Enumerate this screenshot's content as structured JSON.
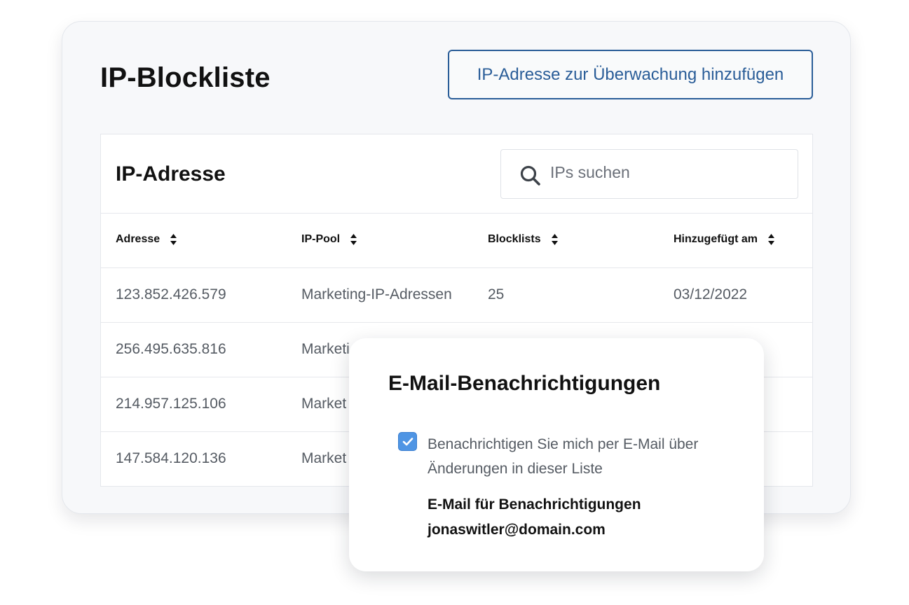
{
  "page": {
    "title": "IP-Blockliste",
    "add_button_label": "IP-Adresse zur Überwachung hinzufügen"
  },
  "table": {
    "title": "IP-Adresse",
    "search": {
      "placeholder": "IPs suchen",
      "icon": "search-icon"
    },
    "columns": [
      "Adresse",
      "IP-Pool",
      "Blocklists",
      "Hinzugefügt am"
    ],
    "rows": [
      {
        "address": "123.852.426.579",
        "pool": "Marketing-IP-Adressen",
        "blocklists": "25",
        "added": "03/12/2022"
      },
      {
        "address": "256.495.635.816",
        "pool": "Marketi",
        "blocklists": "",
        "added": ""
      },
      {
        "address": "214.957.125.106",
        "pool": "Market",
        "blocklists": "",
        "added": ""
      },
      {
        "address": "147.584.120.136",
        "pool": "Market",
        "blocklists": "",
        "added": ""
      }
    ]
  },
  "notifications": {
    "title": "E-Mail-Benachrichtigungen",
    "checkbox_checked": true,
    "checkbox_label": "Benachrichtigen Sie mich per E-Mail über Änderungen in dieser Liste",
    "email_label": "E-Mail für Benachrichtigungen",
    "email_value": "jonaswitler@domain.com"
  },
  "colors": {
    "accent": "#2a5d98",
    "checkbox": "#4f95e4",
    "text_primary": "#111111",
    "text_secondary": "#555b63"
  }
}
